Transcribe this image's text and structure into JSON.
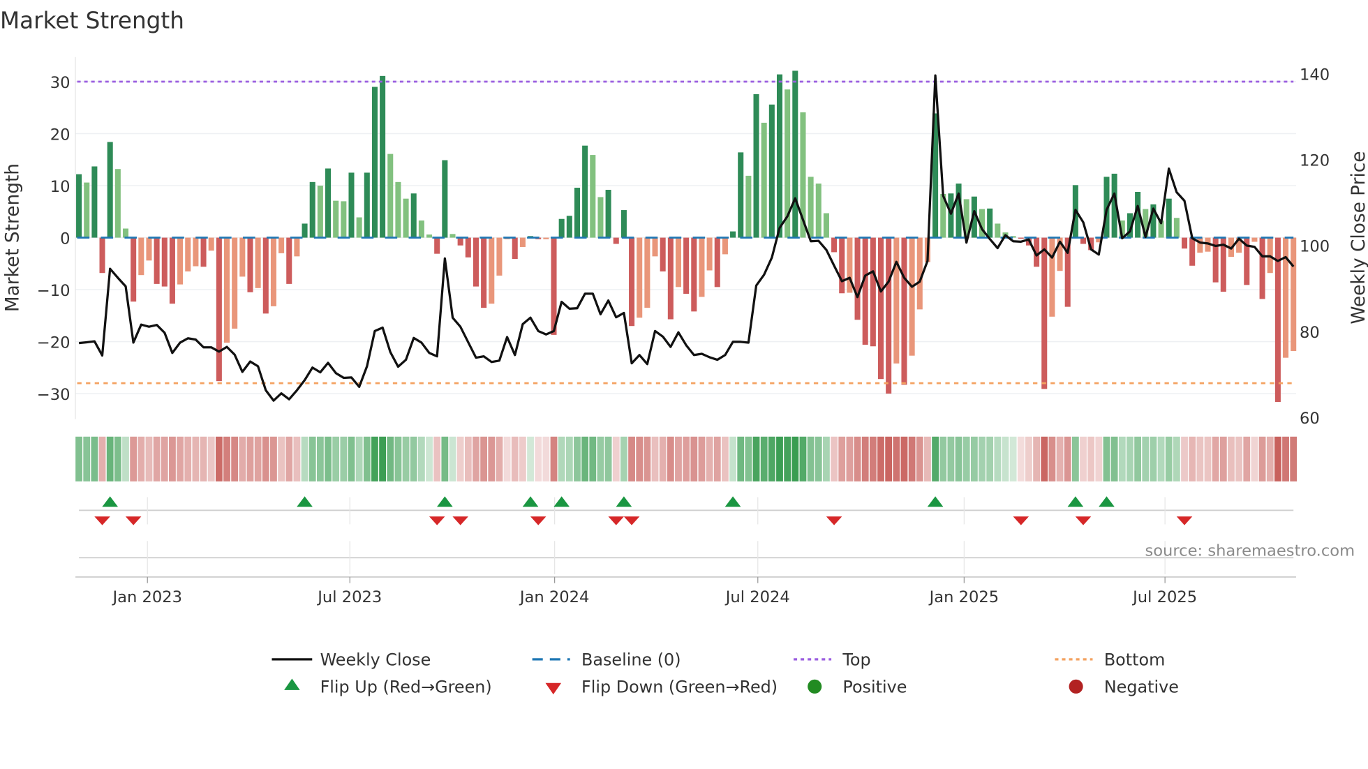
{
  "chart_data": {
    "type": "bar",
    "title": "Market Strength",
    "ylabel": "Market Strength",
    "y2label": "Weekly Close Price",
    "ylim": [
      -35,
      35
    ],
    "y2lim": [
      60,
      142
    ],
    "yticks": [
      30,
      20,
      10,
      0,
      -10,
      -20,
      -30
    ],
    "y2ticks": [
      140,
      120,
      100,
      80,
      60
    ],
    "xlabel": "",
    "xticks": [
      {
        "label": "Jan 2023",
        "week": 9.8
      },
      {
        "label": "Jul 2023",
        "week": 35.8
      },
      {
        "label": "Jan 2024",
        "week": 62.1
      },
      {
        "label": "Jul 2024",
        "week": 88.2
      },
      {
        "label": "Jan 2025",
        "week": 114.7
      },
      {
        "label": "Jul 2025",
        "week": 140.5
      }
    ],
    "top_level": 30,
    "bottom_level": -28,
    "baseline": 0,
    "grid": true,
    "legend_position": "bottom",
    "series": [
      {
        "name": "Market Strength",
        "axis": "left",
        "values": [
          12.2,
          10.6,
          13.7,
          -6.8,
          18.4,
          13.2,
          1.75,
          -12.3,
          -7.2,
          -4.4,
          -8.9,
          -9.4,
          -12.7,
          -9.0,
          -6.5,
          -5.5,
          -5.6,
          -2.5,
          -27.6,
          -20.2,
          -17.5,
          -7.5,
          -10.5,
          -9.7,
          -14.6,
          -13.2,
          -3.0,
          -8.9,
          -3.6,
          2.7,
          10.7,
          10.0,
          13.3,
          7.1,
          7.0,
          12.5,
          3.9,
          12.5,
          29.0,
          31.1,
          16.1,
          10.7,
          7.5,
          8.5,
          3.3,
          0.6,
          -3.1,
          14.9,
          0.7,
          -1.5,
          -3.8,
          -9.4,
          -13.5,
          -12.7,
          -7.3,
          -0.3,
          -4.1,
          -1.8,
          0.3,
          -0.3,
          -0.3,
          -18.7,
          3.6,
          4.2,
          9.6,
          17.7,
          15.9,
          7.8,
          9.2,
          -1.2,
          5.3,
          -17.0,
          -15.4,
          -13.5,
          -3.6,
          -6.5,
          -15.7,
          -9.5,
          -10.8,
          -14.2,
          -11.4,
          -6.3,
          -9.5,
          -3.2,
          1.2,
          16.4,
          11.9,
          27.6,
          22.1,
          25.6,
          31.4,
          28.5,
          32.1,
          24.1,
          11.7,
          10.4,
          4.7,
          -2.8,
          -10.7,
          -10.6,
          -15.8,
          -20.6,
          -20.9,
          -27.2,
          -30.0,
          -24.2,
          -28.3,
          -22.7,
          -13.8,
          -4.7,
          23.9,
          8.4,
          8.5,
          10.4,
          7.4,
          7.9,
          5.5,
          5.6,
          2.7,
          1.0,
          0.3,
          -0.2,
          -1.5,
          -5.6,
          -29.1,
          -15.2,
          -6.4,
          -13.3,
          10.1,
          -1.2,
          -2.4,
          -0.9,
          11.7,
          12.3,
          3.3,
          4.7,
          8.8,
          5.5,
          6.4,
          3.3,
          7.5,
          3.8,
          -2.1,
          -5.4,
          -2.9,
          -2.7,
          -8.6,
          -10.4,
          -3.7,
          -2.9,
          -9.1,
          -0.8,
          -11.8,
          -6.8,
          -31.6,
          -23.1,
          -21.8
        ]
      },
      {
        "name": "Weekly Close",
        "axis": "right",
        "type": "line",
        "values": [
          77.3,
          77.5,
          77.7,
          74.4,
          94.6,
          92.5,
          90.5,
          77.4,
          81.6,
          81.1,
          81.5,
          79.7,
          75.0,
          77.4,
          78.4,
          78.1,
          76.3,
          76.3,
          75.3,
          76.4,
          74.6,
          70.6,
          73.0,
          71.9,
          66.3,
          63.9,
          65.6,
          64.2,
          66.3,
          68.7,
          71.6,
          70.5,
          72.7,
          70.3,
          69.2,
          69.3,
          67.1,
          71.9,
          80.1,
          80.9,
          75.2,
          71.8,
          73.4,
          78.5,
          77.4,
          75.0,
          74.2,
          97.0,
          83.2,
          81.1,
          77.5,
          73.9,
          74.2,
          72.9,
          73.2,
          78.7,
          74.5,
          81.7,
          83.2,
          80.1,
          79.3,
          80.1,
          86.9,
          85.3,
          85.4,
          88.8,
          88.8,
          84.0,
          87.2,
          83.3,
          84.3,
          72.6,
          74.5,
          72.4,
          80.1,
          78.8,
          76.4,
          79.8,
          76.8,
          74.5,
          74.8,
          74.0,
          73.4,
          74.5,
          77.6,
          77.6,
          77.4,
          90.7,
          93.2,
          97.2,
          104.1,
          106.8,
          111.0,
          106.0,
          101.0,
          101.1,
          99.0,
          95.3,
          91.7,
          92.5,
          88.0,
          93.0,
          94.0,
          89.3,
          91.6,
          96.2,
          92.5,
          90.4,
          91.6,
          96.4,
          139.6,
          111.6,
          107.4,
          112.1,
          100.7,
          108.0,
          103.8,
          101.5,
          99.4,
          102.4,
          101.0,
          100.9,
          101.4,
          97.7,
          99.1,
          97.2,
          100.9,
          98.3,
          108.3,
          105.4,
          99.1,
          97.9,
          108.3,
          112.1,
          101.7,
          103.3,
          109.2,
          102.0,
          108.6,
          105.2,
          117.9,
          112.4,
          110.4,
          101.7,
          100.7,
          100.5,
          99.9,
          100.2,
          99.3,
          101.6,
          100.0,
          99.7,
          97.5,
          97.5,
          96.4,
          97.3,
          95.1
        ]
      }
    ]
  },
  "colors": {
    "pos_strong": "#2e8b57",
    "pos_weak": "#82c17f",
    "neg_strong": "#cd5c5c",
    "neg_weak": "#e9967a",
    "baseline": "#1f77b4",
    "top": "#9b5fe0",
    "bottom": "#f4a261",
    "line": "#111111",
    "flip_up": "#1a9641",
    "flip_down": "#d62728",
    "positive": "#228b22",
    "negative": "#b22222"
  },
  "source": "source: sharemaestro.com",
  "legend": {
    "weekly_close": "Weekly Close",
    "baseline": "Baseline (0)",
    "top": "Top",
    "bottom": "Bottom",
    "flip_up": "Flip Up (Red→Green)",
    "flip_down": "Flip Down (Green→Red)",
    "positive": "Positive",
    "negative": "Negative"
  }
}
